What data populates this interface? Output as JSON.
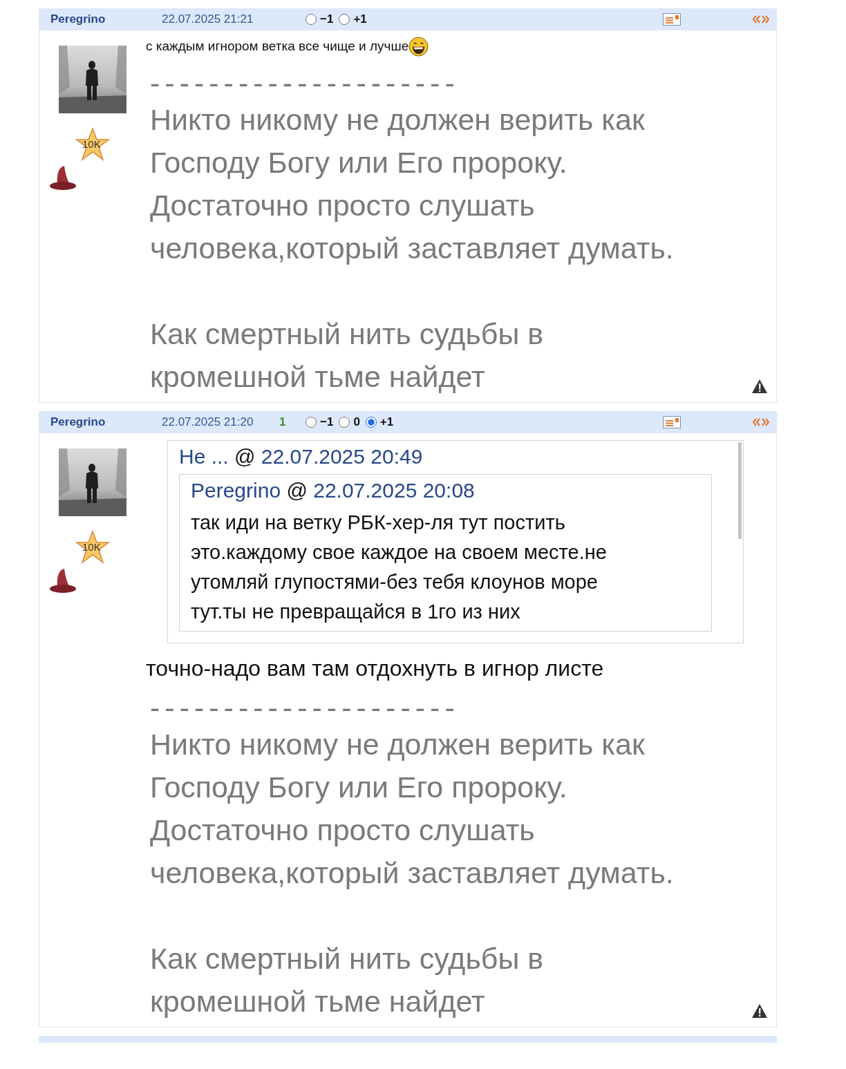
{
  "posts": [
    {
      "author": "Peregrino",
      "date": "22.07.2025 21:21",
      "votes": [
        {
          "label": "−1",
          "selected": false
        },
        {
          "label": "+1",
          "selected": false
        }
      ],
      "badge": "10K",
      "avatar": {
        "kind": "picture"
      },
      "text": "с каждым игнором ветка все чище и лучше",
      "emoji": {
        "kind": "laughing"
      },
      "signature": {
        "rule": "---------------------",
        "paragraphs": [
          [
            "Никто никому не должен верить как",
            "Господу Богу или Его пророку.",
            "Достаточно просто слушать",
            "человека,который заставляет думать."
          ],
          [
            "Как смертный нить судьбы в",
            "кромешной тьме найдет"
          ]
        ]
      }
    },
    {
      "author": "Peregrino",
      "date": "22.07.2025 21:20",
      "score": "1",
      "votes": [
        {
          "label": "−1",
          "selected": false
        },
        {
          "label": "0",
          "selected": false
        },
        {
          "label": "+1",
          "selected": true
        }
      ],
      "badge": "10K",
      "avatar": {
        "kind": "picture"
      },
      "quote": {
        "author": "Не ...",
        "at": "@",
        "date": "22.07.2025 20:49",
        "quote": {
          "author": "Peregrino",
          "at": "@",
          "date": "22.07.2025 20:08",
          "text": [
            "так иди на ветку РБК-хер-ля тут постить",
            "это.каждому свое каждое на своем месте.не",
            "утомляй глупостями-без тебя клоунов море",
            "тут.ты не превращайся в 1го из них"
          ]
        }
      },
      "text": "точно-надо вам там отдохнуть в игнор листе",
      "signature": {
        "rule": "---------------------",
        "paragraphs": [
          [
            "Никто никому не должен верить как",
            "Господу Богу или Его пророку.",
            "Достаточно просто слушать",
            "человека,который заставляет думать."
          ],
          [
            "Как смертный нить судьбы в",
            "кромешной тьме найдет"
          ]
        ]
      }
    }
  ],
  "next_post_cut": true
}
